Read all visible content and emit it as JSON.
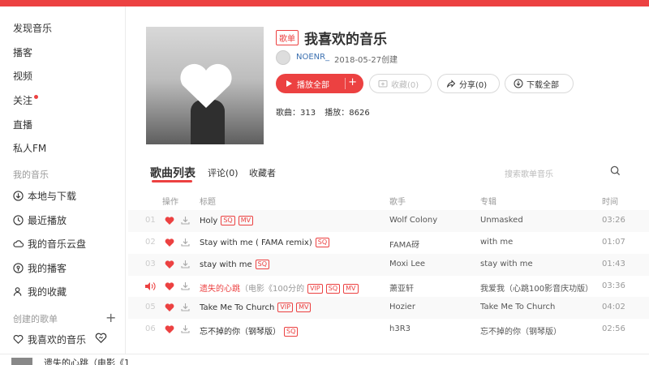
{
  "sidebar": {
    "discover": "发现音乐",
    "podcast": "播客",
    "video": "视频",
    "follow": "关注",
    "live": "直播",
    "fm": "私人FM",
    "my_music_label": "我的音乐",
    "local_download": "本地与下载",
    "recent": "最近播放",
    "cloud": "我的音乐云盘",
    "my_podcast": "我的播客",
    "collection": "我的收藏",
    "created_label": "创建的歌单",
    "add": "+",
    "liked_playlist": "我喜欢的音乐"
  },
  "playlist": {
    "tag": "歌单",
    "title": "我喜欢的音乐",
    "creator": "NOENR_",
    "created": "2018-05-27创建",
    "play_all": "播放全部",
    "plus": "+",
    "collect": "收藏(0)",
    "share": "分享(0)",
    "download_all": "下载全部",
    "songs_label": "歌曲：313",
    "plays_label": "播放：8626"
  },
  "tabs": {
    "songs": "歌曲列表",
    "comments": "评论(0)",
    "subscribers": "收藏者",
    "search_placeholder": "搜索歌单音乐"
  },
  "table": {
    "headers": [
      "操作",
      "标题",
      "歌手",
      "专辑",
      "时间"
    ],
    "rows": [
      {
        "num": "01",
        "title": "Holy",
        "extra": "",
        "badges": [
          "SQ",
          "MV"
        ],
        "artist": "Wolf Colony",
        "album": "Unmasked",
        "time": "03:26"
      },
      {
        "num": "02",
        "title": "Stay with me ( FAMA remix)",
        "extra": "",
        "badges": [
          "SQ"
        ],
        "artist": "FAMA砑",
        "album": "with me",
        "time": "01:07"
      },
      {
        "num": "03",
        "title": "stay with me",
        "extra": "",
        "badges": [
          "SQ"
        ],
        "artist": "Moxi Lee",
        "album": "stay with me",
        "time": "01:43"
      },
      {
        "num": "",
        "title": "遗失的心跳",
        "extra": "（电影《100分的",
        "badges": [
          "VIP",
          "SQ",
          "MV"
        ],
        "artist": "萧亚轩",
        "album": "我爱我（心跳100影音庆功版）",
        "time": "03:36"
      },
      {
        "num": "05",
        "title": "Take Me To Church",
        "extra": "",
        "badges": [
          "VIP",
          "MV"
        ],
        "artist": "Hozier",
        "album": "Take Me To Church",
        "time": "04:02"
      },
      {
        "num": "06",
        "title": "忘不掉的你（钢琴版）",
        "extra": "",
        "badges": [
          "SQ"
        ],
        "artist": "h3R3",
        "album": "忘不掉的你（钢琴版）",
        "time": "02:56"
      }
    ]
  },
  "bottom": {
    "now_playing": "遗失的心跳（电影《1"
  },
  "colors": {
    "accent": "#ec4141"
  }
}
